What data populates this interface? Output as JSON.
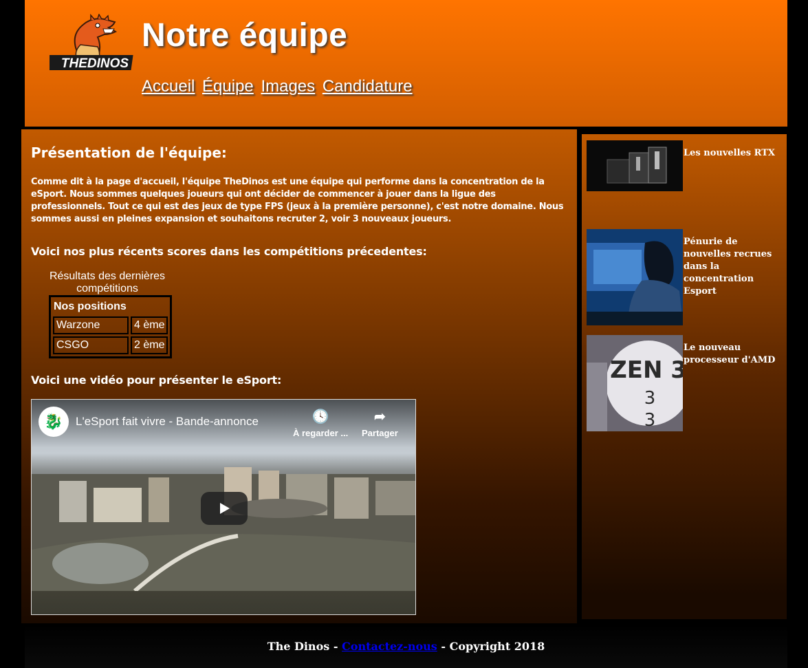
{
  "header": {
    "logo_text": "THEDINOS",
    "title": "Notre équipe",
    "nav": [
      "Accueil",
      "Équipe",
      "Images",
      "Candidature"
    ]
  },
  "main": {
    "heading": "Présentation de l'équipe:",
    "intro": "Comme dit à la page d'accueil, l'équipe TheDinos est une équipe qui performe dans la concentration de la eSport. Nous sommes quelques joueurs qui ont décider de commencer à jouer dans la ligue des professionnels. Tout ce qui est des jeux de type FPS (jeux à la première personne), c'est notre domaine. Nous sommes aussi en pleines expansion et souhaitons recruter 2, voir 3 nouveaux joueurs.",
    "scores_heading": "Voici nos plus récents scores dans les compétitions précedentes:",
    "results_caption": "Résultats des dernières compétitions",
    "results_header": "Nos positions",
    "results": [
      {
        "game": "Warzone",
        "position": "4 ème"
      },
      {
        "game": "CSGO",
        "position": "2 ème"
      }
    ],
    "video_heading": "Voici une vidéo pour présenter le eSport:",
    "video": {
      "title": "L'eSport fait vivre - Bande-annonce",
      "watch_later": "À regarder ...",
      "share": "Partager"
    }
  },
  "sidebar": {
    "news": [
      {
        "title": "Les nouvelles RTX"
      },
      {
        "title": "Pénurie de nouvelles recrues dans la concentration Esport"
      },
      {
        "title": "Le nouveau processeur d'AMD",
        "thumb_text": "ZEN 3"
      }
    ]
  },
  "footer": {
    "before": "The Dinos - ",
    "link": "Contactez-nous",
    "after": " - Copyright 2018"
  },
  "colors": {
    "header_orange": "#ff7400",
    "link_blue": "#0000ee"
  }
}
